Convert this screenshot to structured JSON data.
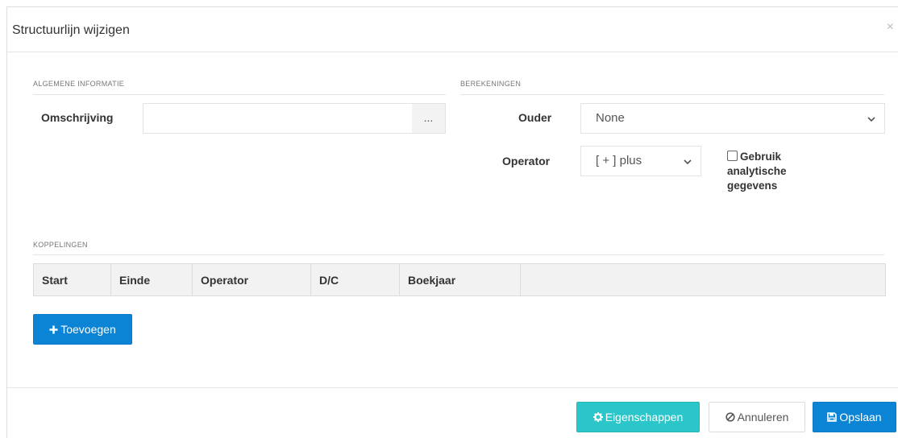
{
  "modal": {
    "title": "Structuurlijn wijzigen",
    "close": "×"
  },
  "sections": {
    "general": "ALGEMENE INFORMATIE",
    "calculations": "BEREKENINGEN",
    "links": "KOPPELINGEN"
  },
  "general": {
    "description_label": "Omschrijving",
    "description_value": "",
    "ellipsis": "..."
  },
  "calculations": {
    "parent_label": "Ouder",
    "parent_value": "None",
    "operator_label": "Operator",
    "operator_value": "[ + ] plus",
    "analytics_label_1": "Gebruik",
    "analytics_label_2": "analytische",
    "analytics_label_3": "gegevens",
    "analytics_checked": false
  },
  "links_table": {
    "columns": [
      "Start",
      "Einde",
      "Operator",
      "D/C",
      "Boekjaar",
      ""
    ]
  },
  "buttons": {
    "add": "Toevoegen",
    "properties": "Eigenschappen",
    "cancel": "Annuleren",
    "save": "Opslaan"
  },
  "colors": {
    "primary": "#0c84d6",
    "teal": "#2bc6c9"
  }
}
